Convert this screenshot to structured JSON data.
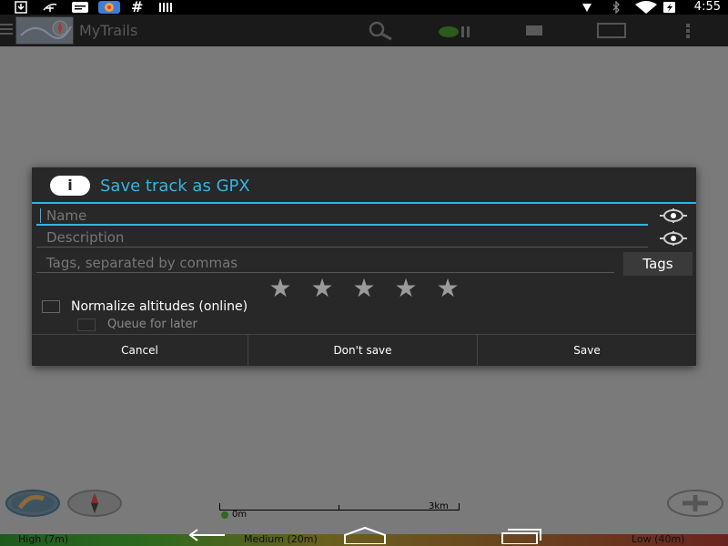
{
  "status_bar": {
    "time": "4:55",
    "left_icons": [
      "download-icon",
      "usb-icon",
      "message-icon",
      "photos-icon",
      "hash-icon",
      "bars-icon"
    ],
    "right_icons": [
      "location-icon",
      "bluetooth-icon",
      "wifi-icon",
      "battery-charging-icon"
    ]
  },
  "action_bar": {
    "app_title": "MyTrails",
    "icons": [
      "menu-icon",
      "app-logo",
      "search-icon",
      "record-pause-icon",
      "stop-icon",
      "map-icon",
      "overflow-menu-icon"
    ]
  },
  "dialog": {
    "title": "Save track as GPX",
    "name_placeholder": "Name",
    "description_placeholder": "Description",
    "tags_placeholder": "Tags, separated by commas",
    "tags_button": "Tags",
    "rating_stars": 5,
    "normalize_label": "Normalize altitudes (online)",
    "queue_label": "Queue for later",
    "buttons": {
      "cancel": "Cancel",
      "dont_save": "Don't save",
      "save": "Save"
    }
  },
  "map": {
    "scale_start": "0m",
    "scale_end": "3km",
    "legend": {
      "high": "High (7m)",
      "medium": "Medium (20m)",
      "low": "Low (40m)"
    }
  },
  "colors": {
    "accent": "#33b5e5",
    "dialog_bg": "#282828",
    "overlay": "#7a7a7a"
  }
}
